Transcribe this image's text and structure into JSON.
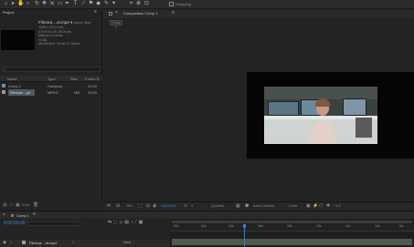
{
  "toolbar": {
    "tools": [
      "home-icon",
      "selection-icon",
      "hand-icon",
      "zoom-icon",
      "orbit-icon",
      "pan-icon",
      "dolly-icon",
      "rect-icon",
      "pen-icon",
      "type-icon",
      "brush-icon",
      "stamp-icon",
      "eraser-icon",
      "roto-icon",
      "puppet-icon"
    ],
    "snapping_label": "Snapping"
  },
  "project": {
    "tab_label": "Project",
    "file_title": "Filmora....ot.mp4 ▾",
    "used_text": ", used 1 time",
    "meta_lines": [
      "1280 x 720 (1.00)",
      "Δ 0;00;01;39, 25.00 fps",
      "Millions of Colors",
      "H.264",
      "48.000 kHz / 32 bit U / Stereo"
    ],
    "columns": [
      "Name",
      "Type",
      "Size",
      "Frame R"
    ],
    "rows": [
      {
        "name": "Comp 1",
        "type": "Composi...",
        "size": "",
        "rate": "25.00"
      },
      {
        "name": "Filmora....p4",
        "type": "MPEG",
        "size": "MB",
        "rate": "25.00"
      }
    ],
    "footer_bpc": "8 bpc"
  },
  "composition": {
    "tab_label": "Composition Comp 1",
    "menu_icon": "≡",
    "subtab": "Comp 1",
    "bar": {
      "zoom": "25%",
      "timecode": "0;00;00;00",
      "resolution": "(Quarter)",
      "camera": "Active Camera",
      "views": "1 View",
      "exposure": "+0.0"
    }
  },
  "timeline": {
    "tab_label": "Comp 1",
    "timecode": "0;00;00;00",
    "layer_name": "Filmora....ot.mp4",
    "layer_mode": "None",
    "ruler": [
      "00s",
      "02s",
      "04s",
      "06s",
      "08s",
      "10s",
      "12s",
      "14s",
      "16s"
    ]
  },
  "colors": {
    "accent": "#3e7bd6",
    "timecode": "#4a86d8",
    "panel": "#232323"
  }
}
